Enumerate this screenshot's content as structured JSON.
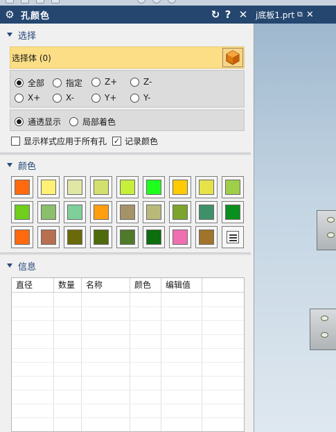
{
  "dialog": {
    "title": "孔颜色",
    "icons": [
      "gear-icon",
      "reset-icon",
      "help-icon",
      "close-icon"
    ],
    "help_glyph": "?",
    "close_glyph": "✕",
    "reset_glyph": "↻"
  },
  "doc_tab": {
    "name": "j底板1.prt",
    "close_glyph": "✕"
  },
  "selection": {
    "header": "选择",
    "select_body_label": "选择体 (0)",
    "direction_options": [
      "全部",
      "指定",
      "Z+",
      "Z-",
      "X+",
      "X-",
      "Y+",
      "Y-"
    ],
    "direction_selected": "全部",
    "display_options": [
      "通透显示",
      "局部着色"
    ],
    "display_selected": "通透显示",
    "apply_all_label": "显示样式应用于所有孔",
    "apply_all_checked": false,
    "record_color_label": "记录颜色",
    "record_color_checked": true
  },
  "colors": {
    "header": "颜色",
    "swatches": [
      "#ff6a10",
      "#fff176",
      "#e0e6a6",
      "#d4e06e",
      "#c6ef3c",
      "#1eff1e",
      "#ffcb05",
      "#e6e24a",
      "#9fcf4a",
      "#6fcf1c",
      "#8cbf6c",
      "#7fcf9a",
      "#ff9f10",
      "#a59268",
      "#b9ba7a",
      "#7ca32c",
      "#3f8f6a",
      "#0a8f1e",
      "#ff6a10",
      "#b86f4f",
      "#6b6a0a",
      "#4e6a0c",
      "#4f7a2a",
      "#0c6e0c",
      "#ef6fb0",
      "#a0742a"
    ],
    "more_colors_icon": "color-list-icon"
  },
  "info": {
    "header": "信息",
    "columns": [
      "直径",
      "数量",
      "名称",
      "颜色",
      "编辑值"
    ],
    "rows": []
  }
}
